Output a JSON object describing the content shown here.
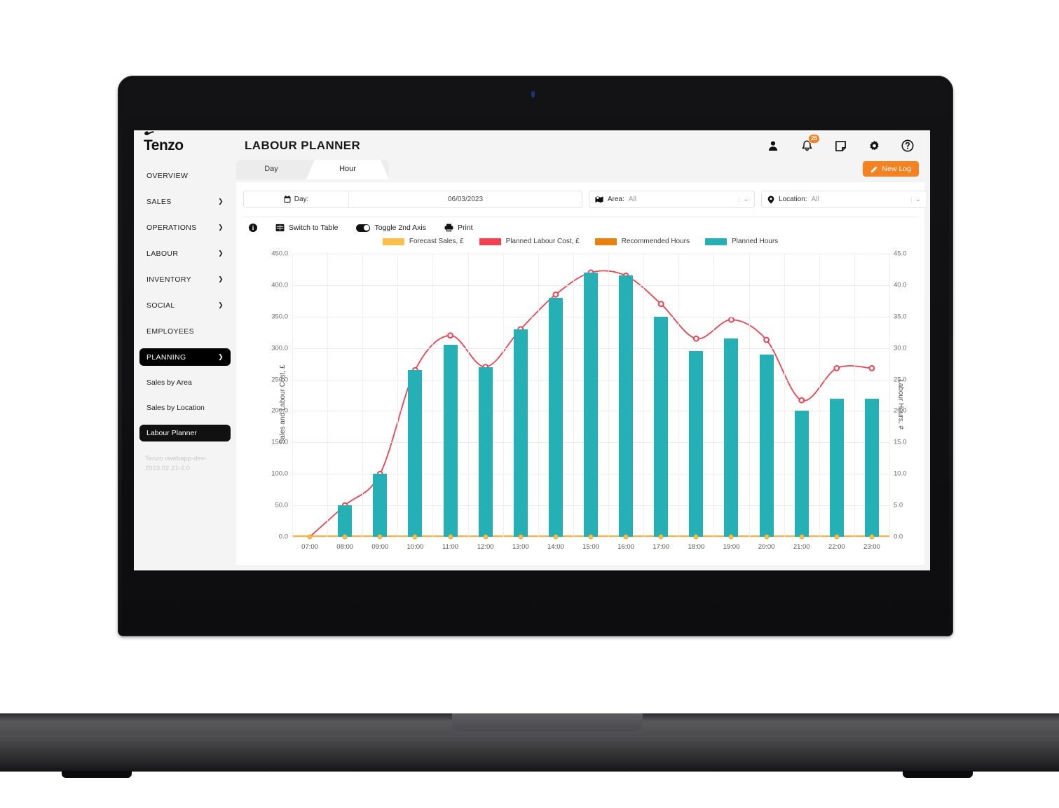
{
  "app": {
    "brand": "Tenzo",
    "page_title": "LABOUR PLANNER",
    "version": "Tenzo vwebapp-dev-2023.02.21-2.0",
    "notification_count": "25",
    "new_log_label": "New Log"
  },
  "top_icons": [
    {
      "name": "user-icon"
    },
    {
      "name": "bell-icon"
    },
    {
      "name": "note-icon"
    },
    {
      "name": "gear-icon"
    },
    {
      "name": "help-icon"
    }
  ],
  "sidebar": {
    "items": [
      {
        "label": "OVERVIEW",
        "expandable": false,
        "active": false
      },
      {
        "label": "SALES",
        "expandable": true,
        "active": false
      },
      {
        "label": "OPERATIONS",
        "expandable": true,
        "active": false
      },
      {
        "label": "LABOUR",
        "expandable": true,
        "active": false
      },
      {
        "label": "INVENTORY",
        "expandable": true,
        "active": false
      },
      {
        "label": "SOCIAL",
        "expandable": true,
        "active": false
      },
      {
        "label": "EMPLOYEES",
        "expandable": false,
        "active": false
      },
      {
        "label": "PLANNING",
        "expandable": true,
        "active": true
      }
    ],
    "sub_items": [
      {
        "label": "Sales by Area",
        "active": false
      },
      {
        "label": "Sales by Location",
        "active": false
      },
      {
        "label": "Labour Planner",
        "active": true
      }
    ]
  },
  "tabs": [
    {
      "label": "Day",
      "active": false
    },
    {
      "label": "Hour",
      "active": true
    }
  ],
  "filters": {
    "day_label": "Day:",
    "day_value": "06/03/2023",
    "area_label": "Area:",
    "area_value": "All",
    "location_label": "Location:",
    "location_value": "All"
  },
  "toolbar": {
    "info_glyph": "i",
    "switch_to_table": "Switch to Table",
    "toggle_2nd_axis": "Toggle 2nd Axis",
    "print": "Print"
  },
  "colors": {
    "forecast_sales": "#fcbf49",
    "planned_labour_cost": "#f4404f",
    "recommended_hours": "#e8820c",
    "planned_hours": "#25b0b5",
    "accent_orange": "#f58220",
    "sidebar_active": "#000000"
  },
  "chart_data": {
    "type": "bar",
    "title": "",
    "xlabel": "",
    "ylabel": "Sales and Labour Cost, £",
    "y2label": "Labour Hours, #",
    "ylim": [
      0,
      450
    ],
    "y2lim": [
      0,
      45
    ],
    "yticks": [
      "0.0",
      "50.0",
      "100.0",
      "150.0",
      "200.0",
      "250.0",
      "300.0",
      "350.0",
      "400.0",
      "450.0"
    ],
    "y2ticks": [
      "0.0",
      "5.0",
      "10.0",
      "15.0",
      "20.0",
      "25.0",
      "30.0",
      "35.0",
      "40.0",
      "45.0"
    ],
    "grid": true,
    "legend_position": "top",
    "categories": [
      "07:00",
      "08:00",
      "09:00",
      "10:00",
      "11:00",
      "12:00",
      "13:00",
      "14:00",
      "15:00",
      "16:00",
      "17:00",
      "18:00",
      "19:00",
      "20:00",
      "21:00",
      "22:00",
      "23:00"
    ],
    "series": [
      {
        "name": "Forecast Sales, £",
        "type": "line",
        "color": "#fcbf49",
        "axis": "left",
        "values": [
          0,
          0,
          0,
          0,
          0,
          0,
          0,
          0,
          0,
          0,
          0,
          0,
          0,
          0,
          0,
          0,
          0
        ]
      },
      {
        "name": "Planned Labour Cost, £",
        "type": "line",
        "color": "#f4404f",
        "axis": "left",
        "values": [
          0,
          50,
          100,
          265,
          320,
          270,
          330,
          385,
          420,
          415,
          370,
          315,
          345,
          313,
          217,
          268,
          268
        ]
      },
      {
        "name": "Recommended Hours",
        "type": "bar",
        "color": "#e8820c",
        "axis": "right",
        "values": [
          0,
          0,
          0,
          0,
          0,
          0,
          0,
          0,
          0,
          0,
          0,
          0,
          0,
          0,
          0,
          0,
          0
        ]
      },
      {
        "name": "Planned Hours",
        "type": "bar",
        "color": "#25b0b5",
        "axis": "right",
        "values": [
          0,
          5,
          10,
          26.5,
          30.5,
          27,
          33,
          38,
          42,
          41.5,
          35,
          29.5,
          31.5,
          29,
          20,
          22,
          22
        ]
      }
    ]
  }
}
